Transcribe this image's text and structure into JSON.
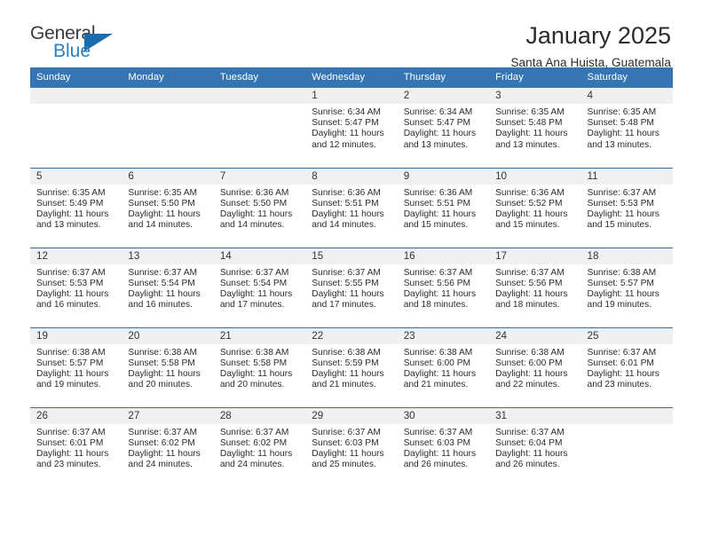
{
  "brand": {
    "name_top": "General",
    "name_bottom": "Blue",
    "triangle_color": "#1b6cae",
    "text_color": "#3a3a3a",
    "accent_color": "#2e7ebb"
  },
  "header": {
    "title": "January 2025",
    "subtitle": "Santa Ana Huista, Guatemala"
  },
  "theme": {
    "header_row_bg": "#3575b4",
    "header_row_text": "#ffffff",
    "row_separator": "#2e6fae",
    "daynum_band_bg": "#f0f0f0",
    "page_bg": "#ffffff",
    "body_text": "#2b2b2b"
  },
  "columns": [
    "Sunday",
    "Monday",
    "Tuesday",
    "Wednesday",
    "Thursday",
    "Friday",
    "Saturday"
  ],
  "labels": {
    "sunrise_prefix": "Sunrise:",
    "sunset_prefix": "Sunset:",
    "daylight_prefix": "Daylight:"
  },
  "weeks": [
    [
      {
        "empty": true
      },
      {
        "empty": true
      },
      {
        "empty": true
      },
      {
        "day": "1",
        "sunrise": "Sunrise: 6:34 AM",
        "sunset": "Sunset: 5:47 PM",
        "daylight": "Daylight: 11 hours and 12 minutes."
      },
      {
        "day": "2",
        "sunrise": "Sunrise: 6:34 AM",
        "sunset": "Sunset: 5:47 PM",
        "daylight": "Daylight: 11 hours and 13 minutes."
      },
      {
        "day": "3",
        "sunrise": "Sunrise: 6:35 AM",
        "sunset": "Sunset: 5:48 PM",
        "daylight": "Daylight: 11 hours and 13 minutes."
      },
      {
        "day": "4",
        "sunrise": "Sunrise: 6:35 AM",
        "sunset": "Sunset: 5:48 PM",
        "daylight": "Daylight: 11 hours and 13 minutes."
      }
    ],
    [
      {
        "day": "5",
        "sunrise": "Sunrise: 6:35 AM",
        "sunset": "Sunset: 5:49 PM",
        "daylight": "Daylight: 11 hours and 13 minutes."
      },
      {
        "day": "6",
        "sunrise": "Sunrise: 6:35 AM",
        "sunset": "Sunset: 5:50 PM",
        "daylight": "Daylight: 11 hours and 14 minutes."
      },
      {
        "day": "7",
        "sunrise": "Sunrise: 6:36 AM",
        "sunset": "Sunset: 5:50 PM",
        "daylight": "Daylight: 11 hours and 14 minutes."
      },
      {
        "day": "8",
        "sunrise": "Sunrise: 6:36 AM",
        "sunset": "Sunset: 5:51 PM",
        "daylight": "Daylight: 11 hours and 14 minutes."
      },
      {
        "day": "9",
        "sunrise": "Sunrise: 6:36 AM",
        "sunset": "Sunset: 5:51 PM",
        "daylight": "Daylight: 11 hours and 15 minutes."
      },
      {
        "day": "10",
        "sunrise": "Sunrise: 6:36 AM",
        "sunset": "Sunset: 5:52 PM",
        "daylight": "Daylight: 11 hours and 15 minutes."
      },
      {
        "day": "11",
        "sunrise": "Sunrise: 6:37 AM",
        "sunset": "Sunset: 5:53 PM",
        "daylight": "Daylight: 11 hours and 15 minutes."
      }
    ],
    [
      {
        "day": "12",
        "sunrise": "Sunrise: 6:37 AM",
        "sunset": "Sunset: 5:53 PM",
        "daylight": "Daylight: 11 hours and 16 minutes."
      },
      {
        "day": "13",
        "sunrise": "Sunrise: 6:37 AM",
        "sunset": "Sunset: 5:54 PM",
        "daylight": "Daylight: 11 hours and 16 minutes."
      },
      {
        "day": "14",
        "sunrise": "Sunrise: 6:37 AM",
        "sunset": "Sunset: 5:54 PM",
        "daylight": "Daylight: 11 hours and 17 minutes."
      },
      {
        "day": "15",
        "sunrise": "Sunrise: 6:37 AM",
        "sunset": "Sunset: 5:55 PM",
        "daylight": "Daylight: 11 hours and 17 minutes."
      },
      {
        "day": "16",
        "sunrise": "Sunrise: 6:37 AM",
        "sunset": "Sunset: 5:56 PM",
        "daylight": "Daylight: 11 hours and 18 minutes."
      },
      {
        "day": "17",
        "sunrise": "Sunrise: 6:37 AM",
        "sunset": "Sunset: 5:56 PM",
        "daylight": "Daylight: 11 hours and 18 minutes."
      },
      {
        "day": "18",
        "sunrise": "Sunrise: 6:38 AM",
        "sunset": "Sunset: 5:57 PM",
        "daylight": "Daylight: 11 hours and 19 minutes."
      }
    ],
    [
      {
        "day": "19",
        "sunrise": "Sunrise: 6:38 AM",
        "sunset": "Sunset: 5:57 PM",
        "daylight": "Daylight: 11 hours and 19 minutes."
      },
      {
        "day": "20",
        "sunrise": "Sunrise: 6:38 AM",
        "sunset": "Sunset: 5:58 PM",
        "daylight": "Daylight: 11 hours and 20 minutes."
      },
      {
        "day": "21",
        "sunrise": "Sunrise: 6:38 AM",
        "sunset": "Sunset: 5:58 PM",
        "daylight": "Daylight: 11 hours and 20 minutes."
      },
      {
        "day": "22",
        "sunrise": "Sunrise: 6:38 AM",
        "sunset": "Sunset: 5:59 PM",
        "daylight": "Daylight: 11 hours and 21 minutes."
      },
      {
        "day": "23",
        "sunrise": "Sunrise: 6:38 AM",
        "sunset": "Sunset: 6:00 PM",
        "daylight": "Daylight: 11 hours and 21 minutes."
      },
      {
        "day": "24",
        "sunrise": "Sunrise: 6:38 AM",
        "sunset": "Sunset: 6:00 PM",
        "daylight": "Daylight: 11 hours and 22 minutes."
      },
      {
        "day": "25",
        "sunrise": "Sunrise: 6:37 AM",
        "sunset": "Sunset: 6:01 PM",
        "daylight": "Daylight: 11 hours and 23 minutes."
      }
    ],
    [
      {
        "day": "26",
        "sunrise": "Sunrise: 6:37 AM",
        "sunset": "Sunset: 6:01 PM",
        "daylight": "Daylight: 11 hours and 23 minutes."
      },
      {
        "day": "27",
        "sunrise": "Sunrise: 6:37 AM",
        "sunset": "Sunset: 6:02 PM",
        "daylight": "Daylight: 11 hours and 24 minutes."
      },
      {
        "day": "28",
        "sunrise": "Sunrise: 6:37 AM",
        "sunset": "Sunset: 6:02 PM",
        "daylight": "Daylight: 11 hours and 24 minutes."
      },
      {
        "day": "29",
        "sunrise": "Sunrise: 6:37 AM",
        "sunset": "Sunset: 6:03 PM",
        "daylight": "Daylight: 11 hours and 25 minutes."
      },
      {
        "day": "30",
        "sunrise": "Sunrise: 6:37 AM",
        "sunset": "Sunset: 6:03 PM",
        "daylight": "Daylight: 11 hours and 26 minutes."
      },
      {
        "day": "31",
        "sunrise": "Sunrise: 6:37 AM",
        "sunset": "Sunset: 6:04 PM",
        "daylight": "Daylight: 11 hours and 26 minutes."
      },
      {
        "empty": true
      }
    ]
  ]
}
